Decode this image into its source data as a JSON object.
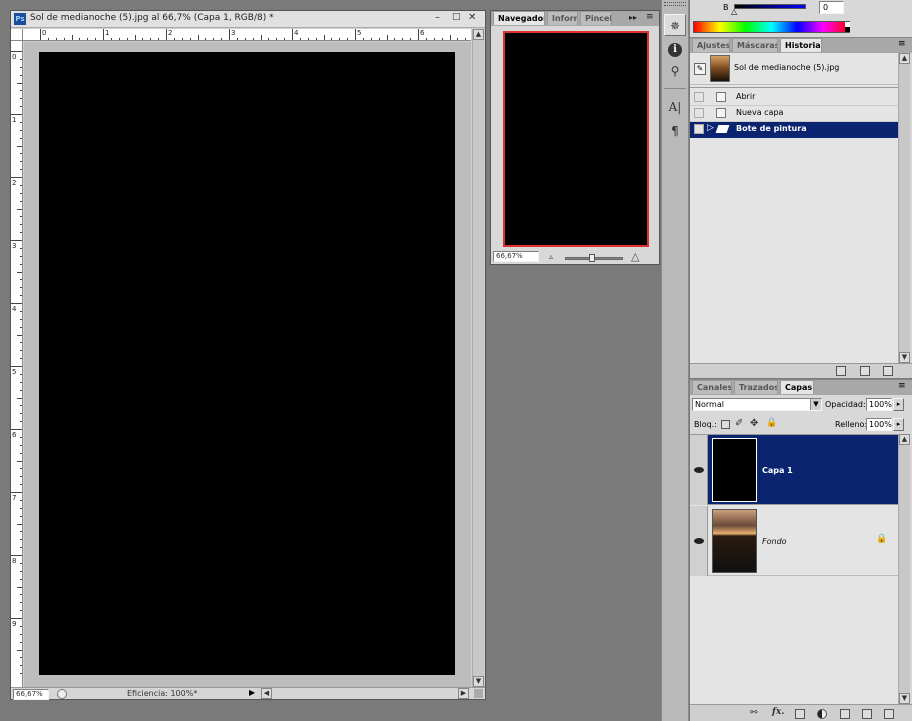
{
  "document": {
    "title": "Sol de medianoche (5).jpg al 66,7% (Capa 1, RGB/8) *",
    "ruler_h": [
      "0",
      "1",
      "2",
      "3",
      "4",
      "5",
      "6"
    ],
    "ruler_v": [
      "0",
      "1",
      "2",
      "3",
      "4",
      "5",
      "6",
      "7",
      "8",
      "9"
    ],
    "zoom": "66,67%",
    "status": "Eficiencia: 100%*"
  },
  "navigator": {
    "tabs": [
      "Navegador",
      "Inform",
      "Pincel"
    ],
    "zoom": "66,67%"
  },
  "color": {
    "channel_label": "B",
    "channel_value": "0"
  },
  "history": {
    "tabs": [
      "Ajustes",
      "Máscaras",
      "Historia"
    ],
    "snapshot": "Sol de medianoche (5).jpg",
    "items": [
      "Abrir",
      "Nueva capa",
      "Bote de pintura"
    ]
  },
  "layers": {
    "tabs": [
      "Canales",
      "Trazados",
      "Capas"
    ],
    "blend_mode": "Normal",
    "opacity_label": "Opacidad:",
    "opacity": "100%",
    "lock_label": "Bloq.:",
    "fill_label": "Relleno:",
    "fill": "100%",
    "items": [
      {
        "name": "Capa 1",
        "selected": true
      },
      {
        "name": "Fondo",
        "selected": false
      }
    ]
  }
}
